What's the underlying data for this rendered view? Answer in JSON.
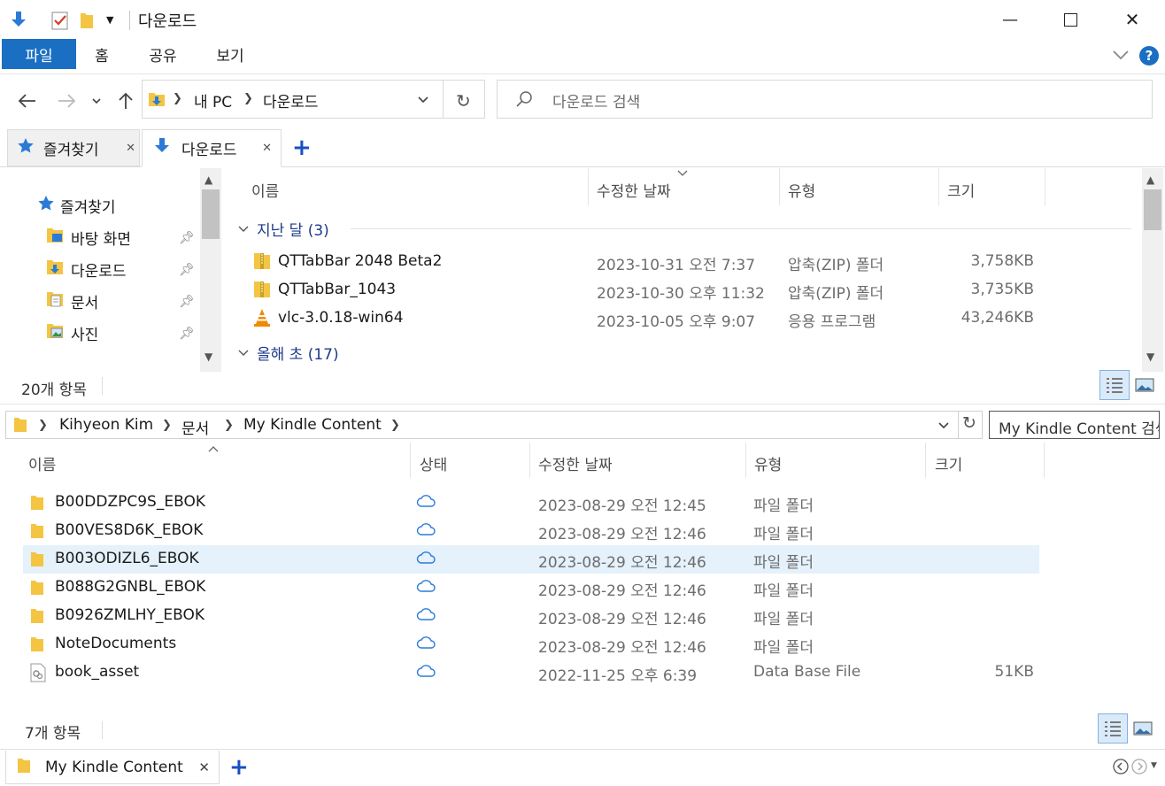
{
  "window": {
    "title": "다운로드",
    "minimize_icon": "—",
    "maximize_icon": "☐",
    "close_icon": "✕"
  },
  "ribbon": {
    "tabs": [
      "파일",
      "홈",
      "공유",
      "보기"
    ],
    "help_icon": "?"
  },
  "nav": {
    "breadcrumb": [
      "내 PC",
      "다운로드"
    ],
    "search_placeholder": "다운로드 검색"
  },
  "tabs": {
    "items": [
      {
        "label": "즐겨찾기",
        "active": false
      },
      {
        "label": "다운로드",
        "active": true
      }
    ],
    "add": "+"
  },
  "navpane": {
    "root": "즐겨찾기",
    "items": [
      "바탕 화면",
      "다운로드",
      "문서",
      "사진"
    ]
  },
  "top_pane": {
    "columns": [
      "이름",
      "수정한 날짜",
      "유형",
      "크기"
    ],
    "groups": [
      {
        "label": "지난 달 (3)",
        "files": [
          {
            "name": "QTTabBar 2048 Beta2",
            "date": "2023-10-31 오전 7:37",
            "type": "압축(ZIP) 폴더",
            "size": "3,758KB",
            "icon": "zip-icon"
          },
          {
            "name": "QTTabBar_1043",
            "date": "2023-10-30 오후 11:32",
            "type": "압축(ZIP) 폴더",
            "size": "3,735KB",
            "icon": "zip-icon"
          },
          {
            "name": "vlc-3.0.18-win64",
            "date": "2023-10-05 오후 9:07",
            "type": "응용 프로그램",
            "size": "43,246KB",
            "icon": "vlc-icon"
          }
        ]
      },
      {
        "label": "올해 초 (17)",
        "files": []
      }
    ],
    "status": "20개 항목"
  },
  "bottom_pane": {
    "breadcrumb": [
      "Kihyeon Kim",
      "문서",
      "My Kindle Content"
    ],
    "search_placeholder": "My Kindle Content 검색",
    "columns": [
      "이름",
      "상태",
      "수정한 날짜",
      "유형",
      "크기"
    ],
    "files": [
      {
        "name": "B00DDZPC9S_EBOK",
        "date": "2023-08-29 오전 12:45",
        "type": "파일 폴더",
        "size": "",
        "selected": false
      },
      {
        "name": "B00VES8D6K_EBOK",
        "date": "2023-08-29 오전 12:46",
        "type": "파일 폴더",
        "size": "",
        "selected": false
      },
      {
        "name": "B003ODIZL6_EBOK",
        "date": "2023-08-29 오전 12:46",
        "type": "파일 폴더",
        "size": "",
        "selected": true
      },
      {
        "name": "B088G2GNBL_EBOK",
        "date": "2023-08-29 오전 12:46",
        "type": "파일 폴더",
        "size": "",
        "selected": false
      },
      {
        "name": "B0926ZMLHY_EBOK",
        "date": "2023-08-29 오전 12:46",
        "type": "파일 폴더",
        "size": "",
        "selected": false
      },
      {
        "name": "NoteDocuments",
        "date": "2023-08-29 오전 12:46",
        "type": "파일 폴더",
        "size": "",
        "selected": false
      },
      {
        "name": "book_asset",
        "date": "2022-11-25 오후 6:39",
        "type": "Data Base File",
        "size": "51KB",
        "selected": false
      }
    ],
    "status": "7개 항목",
    "tab_label": "My Kindle Content",
    "tab_add": "+"
  },
  "colors": {
    "accent": "#1a6fc2",
    "selected_row": "#e5f1fb",
    "group_text": "#1e3a8a",
    "folder": "#f4c542"
  }
}
